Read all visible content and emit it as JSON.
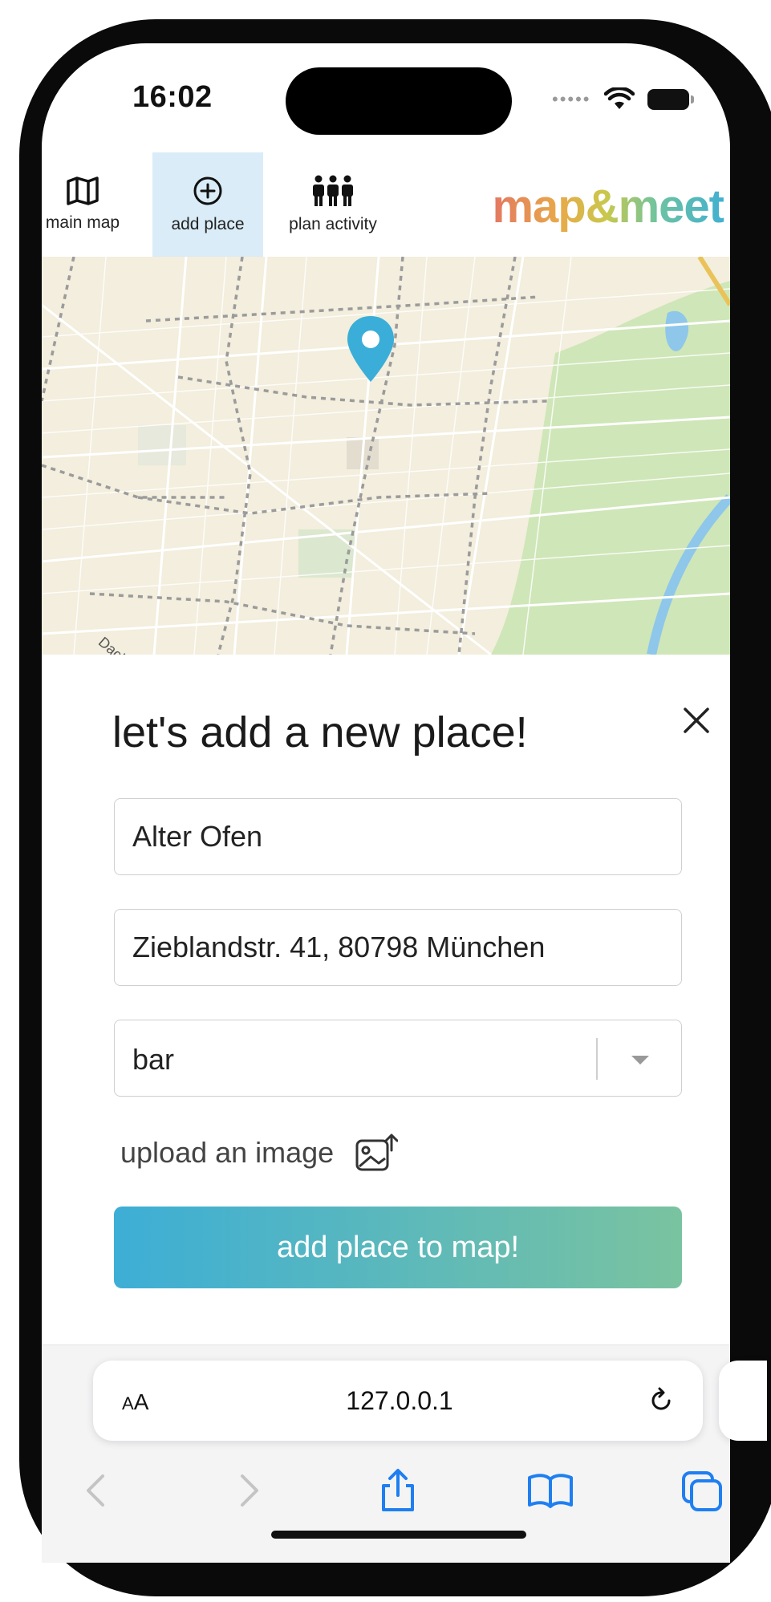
{
  "status_bar": {
    "time": "16:02"
  },
  "nav": {
    "items": [
      {
        "label": "main map",
        "icon": "map-icon"
      },
      {
        "label": "add place",
        "icon": "add-circle-icon",
        "active": true
      },
      {
        "label": "plan activity",
        "icon": "group-icon"
      }
    ],
    "brand": "map&meet"
  },
  "map": {
    "street_label": "Dachauer Straße",
    "marker_color": "#3aaed8"
  },
  "form": {
    "title": "let's add a new place!",
    "name_value": "Alter Ofen",
    "address_value": "Zieblandstr. 41, 80798 München",
    "category_value": "bar",
    "upload_label": "upload an image",
    "submit_label": "add place to map!"
  },
  "browser": {
    "text_size_label_big": "A",
    "text_size_label_small": "A",
    "url": "127.0.0.1"
  },
  "colors": {
    "accent_start": "#3daed6",
    "accent_end": "#7ac3a0",
    "nav_active_bg": "#d9ecf7"
  }
}
